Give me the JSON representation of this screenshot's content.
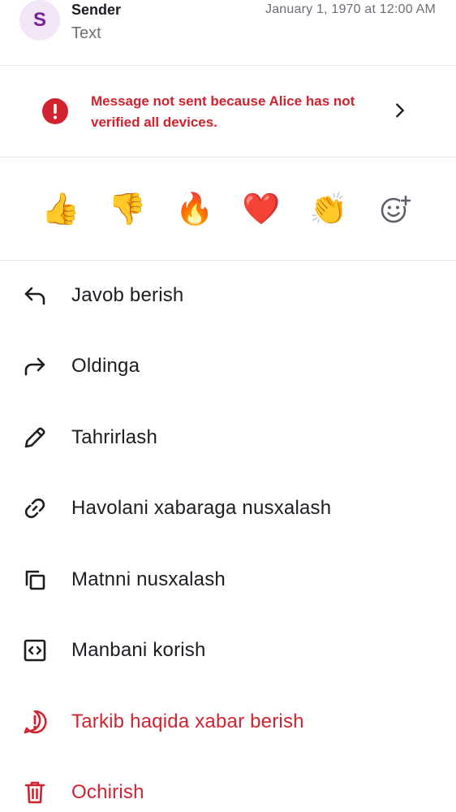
{
  "header": {
    "avatar_letter": "S",
    "sender_name": "Sender",
    "message_text": "Text",
    "timestamp": "January 1, 1970 at 12:00 AM"
  },
  "error_banner": {
    "message": "Message not sent because Alice has not verified all devices."
  },
  "reactions": [
    {
      "icon": "thumbs-up-emoji",
      "glyph": "👍"
    },
    {
      "icon": "thumbs-down-emoji",
      "glyph": "👎"
    },
    {
      "icon": "fire-emoji",
      "glyph": "🔥"
    },
    {
      "icon": "red-heart-emoji",
      "glyph": "❤️"
    },
    {
      "icon": "clapping-hands-emoji",
      "glyph": "👏"
    },
    {
      "icon": "add-reaction-icon",
      "glyph": ""
    }
  ],
  "actions": [
    {
      "label": "Javob berish",
      "icon": "reply-icon"
    },
    {
      "label": "Oldinga",
      "icon": "forward-icon"
    },
    {
      "label": "Tahrirlash",
      "icon": "edit-pencil-icon"
    },
    {
      "label": "Havolani xabaraga nusxalash",
      "icon": "link-icon"
    },
    {
      "label": "Matnni nusxalash",
      "icon": "copy-icon"
    },
    {
      "label": "Manbani korish",
      "icon": "view-source-icon"
    },
    {
      "label": "Tarkib haqida xabar berish",
      "icon": "report-icon"
    },
    {
      "label": "Ochirish",
      "icon": "trash-icon"
    }
  ],
  "colors": {
    "danger": "#d1232f",
    "avatar_bg": "#f3e6f6",
    "avatar_fg": "#7b1f9a",
    "secondary_text": "#6b6f76"
  }
}
